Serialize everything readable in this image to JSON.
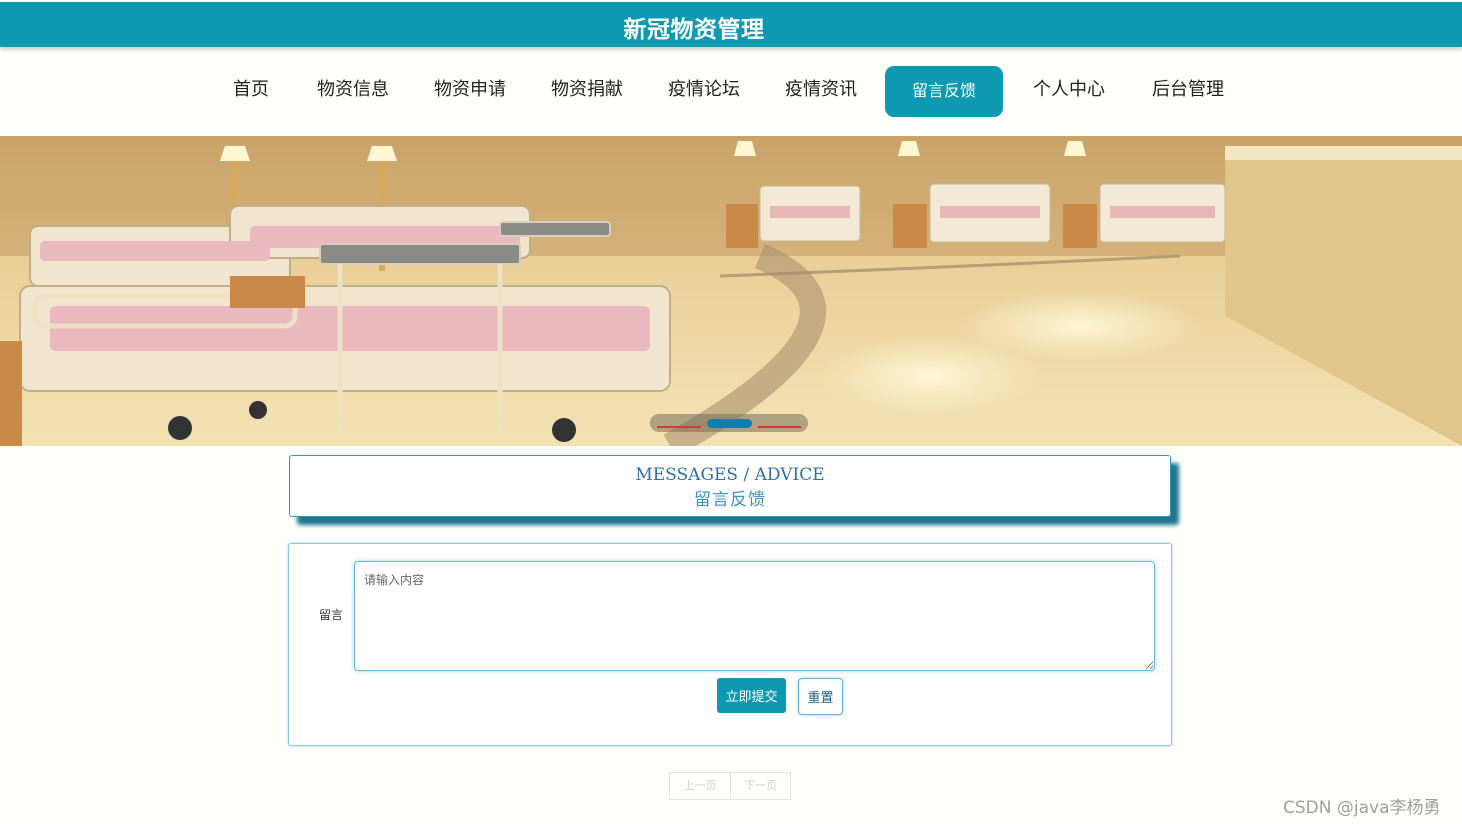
{
  "header": {
    "title": "新冠物资管理"
  },
  "nav": {
    "items": [
      {
        "label": "首页"
      },
      {
        "label": "物资信息"
      },
      {
        "label": "物资申请"
      },
      {
        "label": "物资捐献"
      },
      {
        "label": "疫情论坛"
      },
      {
        "label": "疫情资讯"
      },
      {
        "label": "留言反馈",
        "active": true
      },
      {
        "label": "个人中心"
      },
      {
        "label": "后台管理"
      }
    ]
  },
  "banner": {
    "image": "hospital-ward-photo",
    "slides": 3,
    "active_slide": 2
  },
  "section": {
    "title_en": "MESSAGES / ADVICE",
    "title_cn": "留言反馈"
  },
  "form": {
    "label": "留言",
    "placeholder": "请输入内容",
    "value": "",
    "submit_label": "立即提交",
    "reset_label": "重置"
  },
  "pagination": {
    "prev": "上一页",
    "next": "下一页"
  },
  "watermark": "CSDN @java李杨勇",
  "colors": {
    "primary": "#0d9ab0",
    "border": "#5bb5d6",
    "title_text": "#2d6fa6"
  }
}
